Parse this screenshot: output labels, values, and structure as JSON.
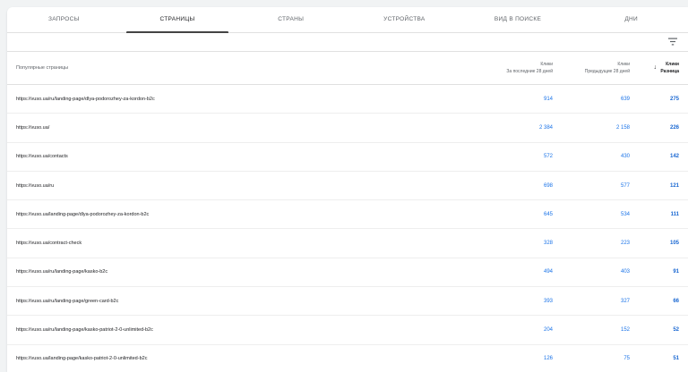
{
  "tabs": [
    {
      "label": "ЗАПРОСЫ",
      "active": false
    },
    {
      "label": "СТРАНИЦЫ",
      "active": true
    },
    {
      "label": "СТРАНЫ",
      "active": false
    },
    {
      "label": "УСТРОЙСТВА",
      "active": false
    },
    {
      "label": "ВИД В ПОИСКЕ",
      "active": false
    },
    {
      "label": "ДНИ",
      "active": false
    }
  ],
  "toolbar": {
    "filter_icon": "filter-icon"
  },
  "table": {
    "header": {
      "page": "Популярные страницы",
      "col1_title": "Клики",
      "col1_sub": "За последние 28 дней",
      "col2_title": "Клики",
      "col2_sub": "Предыдущие 28 дней",
      "col3_title": "Клики",
      "col3_sub": "Разница",
      "sort_icon": "arrow-down-icon"
    },
    "rows": [
      {
        "url": "https://vuso.ua/ru/landing-page/dlya-podorozhey-za-kordon-b2c",
        "last": "914",
        "prev": "639",
        "diff": "275"
      },
      {
        "url": "https://vuso.ua/",
        "last": "2 384",
        "prev": "2 158",
        "diff": "226"
      },
      {
        "url": "https://vuso.ua/contacts",
        "last": "572",
        "prev": "430",
        "diff": "142"
      },
      {
        "url": "https://vuso.ua/ru",
        "last": "698",
        "prev": "577",
        "diff": "121"
      },
      {
        "url": "https://vuso.ua/landing-page/dlya-podorozhey-za-kordon-b2c",
        "last": "645",
        "prev": "534",
        "diff": "111"
      },
      {
        "url": "https://vuso.ua/contract-check",
        "last": "328",
        "prev": "223",
        "diff": "105"
      },
      {
        "url": "https://vuso.ua/ru/landing-page/kasko-b2c",
        "last": "494",
        "prev": "403",
        "diff": "91"
      },
      {
        "url": "https://vuso.ua/ru/landing-page/green-card-b2c",
        "last": "393",
        "prev": "327",
        "diff": "66"
      },
      {
        "url": "https://vuso.ua/ru/landing-page/kasko-patriot-2-0-unlimited-b2c",
        "last": "204",
        "prev": "152",
        "diff": "52"
      },
      {
        "url": "https://vuso.ua/landing-page/kasko-patriot-2-0-unlimited-b2c",
        "last": "126",
        "prev": "75",
        "diff": "51"
      }
    ]
  },
  "colors": {
    "accent": "#1a73e8"
  }
}
